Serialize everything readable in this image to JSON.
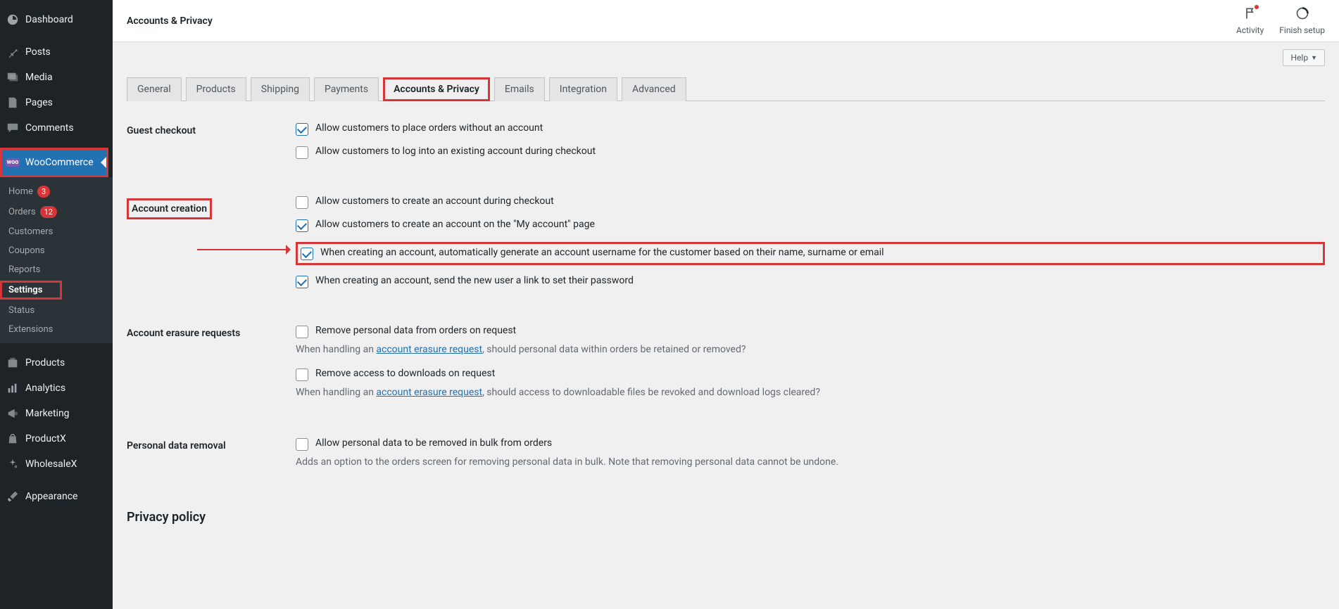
{
  "sidebar": {
    "items": [
      {
        "label": "Dashboard"
      },
      {
        "label": "Posts"
      },
      {
        "label": "Media"
      },
      {
        "label": "Pages"
      },
      {
        "label": "Comments"
      },
      {
        "label": "WooCommerce"
      },
      {
        "label": "Products"
      },
      {
        "label": "Analytics"
      },
      {
        "label": "Marketing"
      },
      {
        "label": "ProductX"
      },
      {
        "label": "WholesaleX"
      },
      {
        "label": "Appearance"
      }
    ],
    "wooSub": [
      {
        "label": "Home",
        "badge": "3"
      },
      {
        "label": "Orders",
        "badge": "12"
      },
      {
        "label": "Customers"
      },
      {
        "label": "Coupons"
      },
      {
        "label": "Reports"
      },
      {
        "label": "Settings"
      },
      {
        "label": "Status"
      },
      {
        "label": "Extensions"
      }
    ]
  },
  "topbar": {
    "title": "Accounts & Privacy",
    "activity": "Activity",
    "finish": "Finish setup",
    "help": "Help"
  },
  "tabs": [
    "General",
    "Products",
    "Shipping",
    "Payments",
    "Accounts & Privacy",
    "Emails",
    "Integration",
    "Advanced"
  ],
  "sections": {
    "guestCheckout": {
      "label": "Guest checkout",
      "opt1": "Allow customers to place orders without an account",
      "opt2": "Allow customers to log into an existing account during checkout"
    },
    "accountCreation": {
      "label": "Account creation",
      "opt1": "Allow customers to create an account during checkout",
      "opt2": "Allow customers to create an account on the \"My account\" page",
      "opt3": "When creating an account, automatically generate an account username for the customer based on their name, surname or email",
      "opt4": "When creating an account, send the new user a link to set their password"
    },
    "erasure": {
      "label": "Account erasure requests",
      "opt1": "Remove personal data from orders on request",
      "desc1a": "When handling an ",
      "desc1link": "account erasure request",
      "desc1b": ", should personal data within orders be retained or removed?",
      "opt2": "Remove access to downloads on request",
      "desc2a": "When handling an ",
      "desc2link": "account erasure request",
      "desc2b": ", should access to downloadable files be revoked and download logs cleared?"
    },
    "removal": {
      "label": "Personal data removal",
      "opt1": "Allow personal data to be removed in bulk from orders",
      "desc": "Adds an option to the orders screen for removing personal data in bulk. Note that removing personal data cannot be undone."
    },
    "privacy": {
      "label": "Privacy policy"
    }
  }
}
